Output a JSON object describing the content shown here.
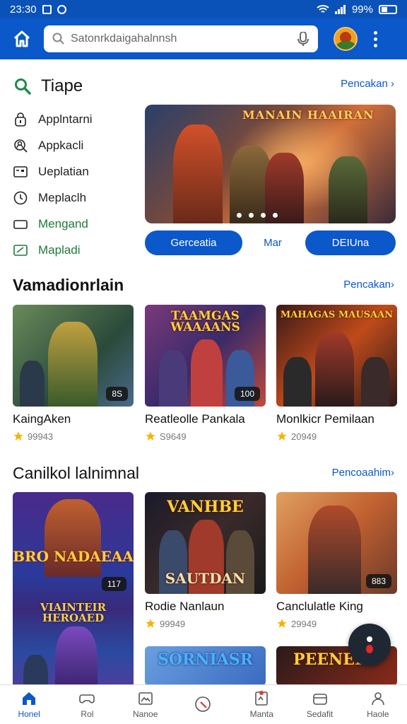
{
  "status_bar": {
    "time": "23:30",
    "battery": "99%"
  },
  "search": {
    "value": "Satonrkdaigahalnnsh"
  },
  "top_section": {
    "title": "Tiape",
    "link": "Pencakan ›",
    "sidebar": [
      {
        "label": "Applntarni",
        "icon": "lock-icon"
      },
      {
        "label": "Appkacli",
        "icon": "search-user-icon"
      },
      {
        "label": "Ueplatian",
        "icon": "card-icon"
      },
      {
        "label": "Meplaclh",
        "icon": "clock-icon"
      },
      {
        "label": "Mengand",
        "icon": "rectangle-icon"
      },
      {
        "label": "Mapladi",
        "icon": "check-box-icon"
      }
    ],
    "banner": {
      "logo": "MANAIN HAAIRAN"
    },
    "buttons": {
      "left": "Gerceatia",
      "middle": "Mar",
      "right": "DEIUna"
    }
  },
  "section2": {
    "title": "Vamadionrlain",
    "link": "Pencakan›",
    "cards": [
      {
        "name": "KaingAken",
        "rating": "99943",
        "badge": "8S"
      },
      {
        "name": "Reatleolle Pankala",
        "rating": "S9649",
        "badge": "100",
        "logo": "TAAMGAS WAAAANS"
      },
      {
        "name": "Monlkicr Pemilaan",
        "rating": "20949",
        "logo": "MAHAGAS MAUSAAN"
      }
    ]
  },
  "section3": {
    "title": "Canilkol lalnimnal",
    "link": "Pencoaahim›",
    "cards": [
      {
        "logo_top": "BRO NADAEAA",
        "badge": "117",
        "logo_bottom": "VIAINTEIR HEROAED"
      },
      {
        "name": "Rodie Nanlaun",
        "rating": "99949",
        "logo_top": "VANHBE",
        "logo_bottom": "SAUTDAN"
      },
      {
        "name": "Canclulatle King",
        "rating": "29949",
        "badge": "883"
      }
    ],
    "partial_cards": [
      {
        "logo": "SORNIASR"
      },
      {
        "logo": "PEENEEO"
      }
    ]
  },
  "bottom_nav": [
    {
      "label": "Honel",
      "icon": "home-icon",
      "active": true
    },
    {
      "label": "Rol",
      "icon": "controller-icon"
    },
    {
      "label": "Nanoe",
      "icon": "photo-icon"
    },
    {
      "label": "",
      "icon": "search-icon"
    },
    {
      "label": "Manta",
      "icon": "badge-icon"
    },
    {
      "label": "Sedafit",
      "icon": "wallet-icon"
    },
    {
      "label": "Haole",
      "icon": "person-icon"
    }
  ]
}
